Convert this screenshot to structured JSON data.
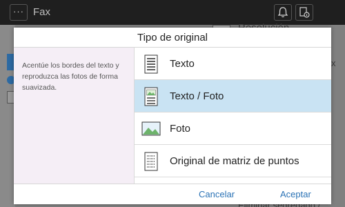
{
  "app": {
    "menu_label": "···",
    "title": "Fax",
    "icons": [
      "bell-icon",
      "document-info-icon"
    ]
  },
  "background": {
    "right_text_top": "Resolución",
    "right_text_bottom": "Eliminar segregado /",
    "right_close": "x"
  },
  "dialog": {
    "title": "Tipo de original",
    "description": "Acentúe los bordes del texto y reproduzca las fotos de forma suavizada.",
    "options": [
      {
        "label": "Texto",
        "icon": "text-document-icon",
        "selected": false
      },
      {
        "label": "Texto / Foto",
        "icon": "text-photo-document-icon",
        "selected": true
      },
      {
        "label": "Foto",
        "icon": "photo-icon",
        "selected": false
      },
      {
        "label": "Original de matriz de puntos",
        "icon": "dot-matrix-document-icon",
        "selected": false
      }
    ],
    "cancel_label": "Cancelar",
    "accept_label": "Aceptar"
  },
  "colors": {
    "selected_row": "#c9e3f3",
    "button_text": "#2a72b5",
    "description_bg": "#f5eef6"
  }
}
